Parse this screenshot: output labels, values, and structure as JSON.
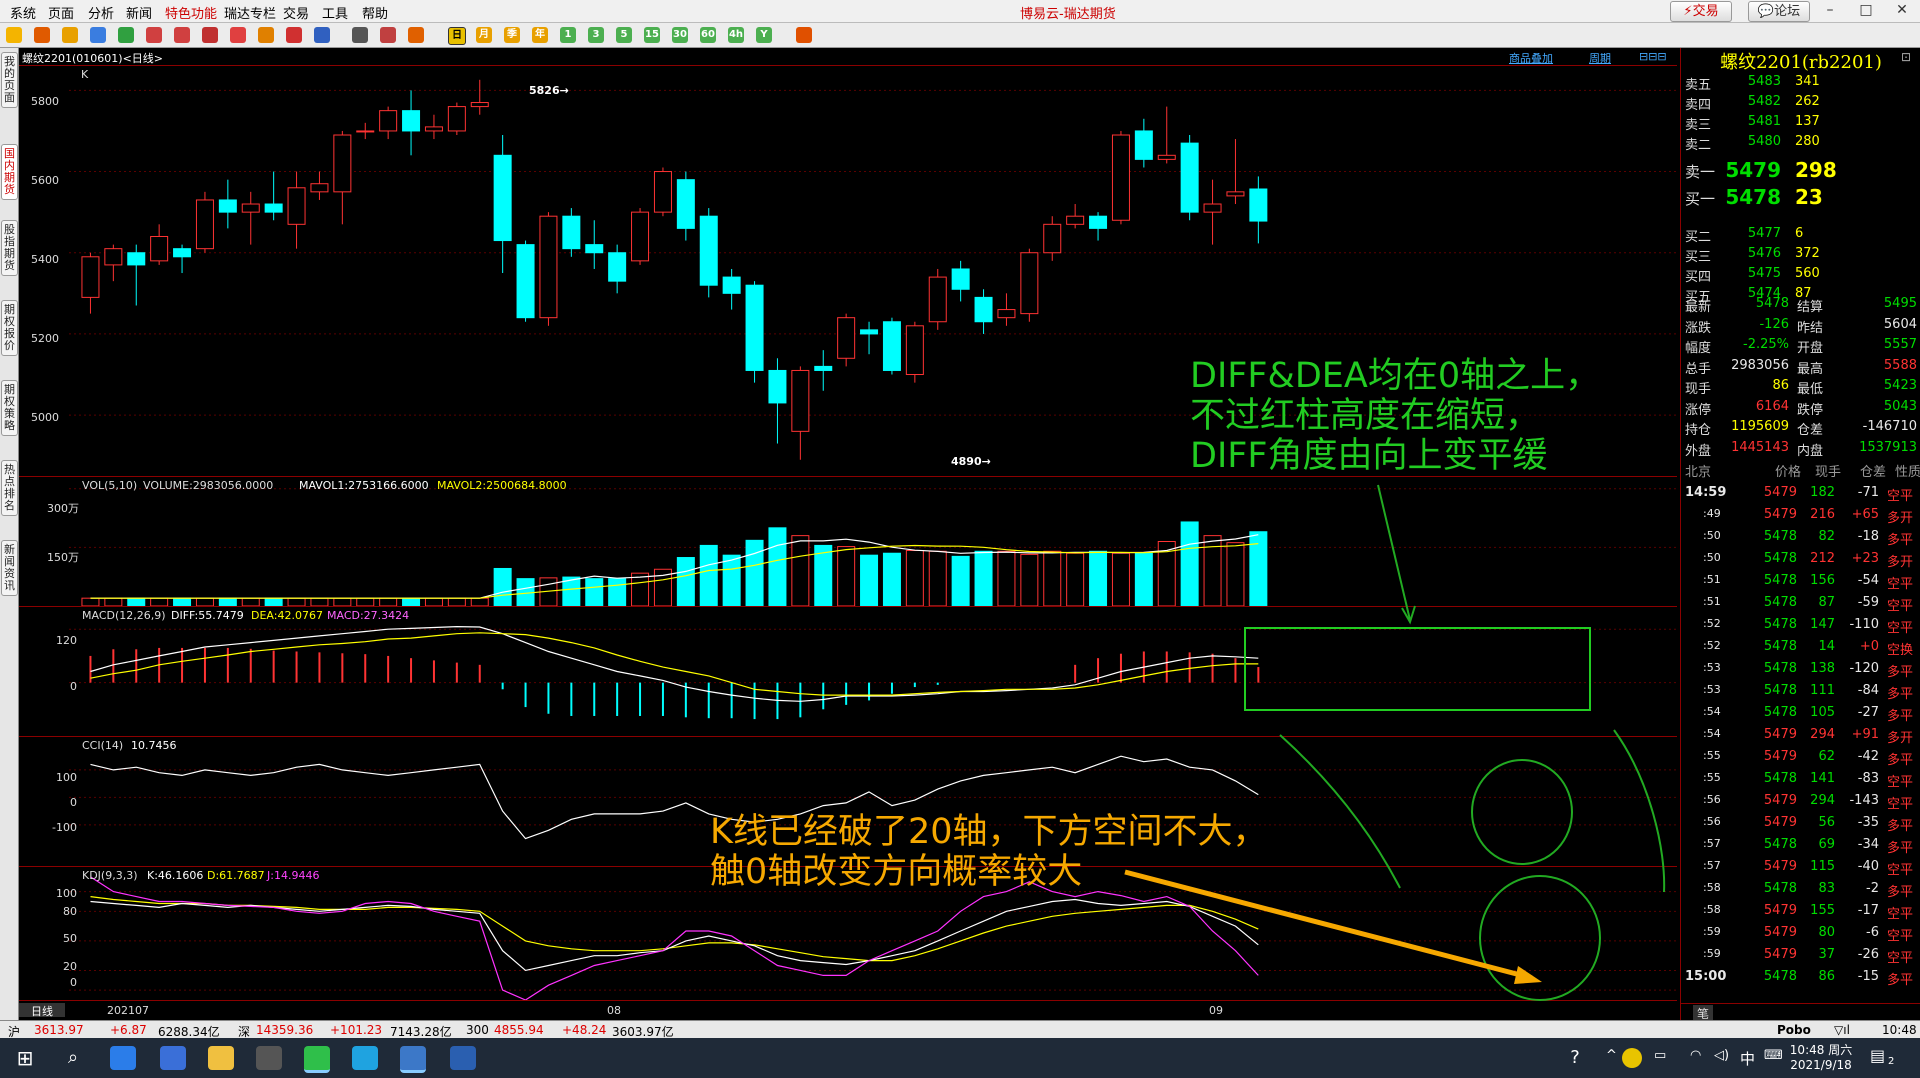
{
  "menu": {
    "items": [
      "系统",
      "页面",
      "分析",
      "新闻",
      "特色功能",
      "瑞达专栏",
      "交易",
      "工具",
      "帮助"
    ],
    "app_title": "博易云-瑞达期货",
    "trade_button": "交易",
    "forum_button": "论坛"
  },
  "toolbar": {
    "period_buttons": [
      "日",
      "月",
      "季",
      "年",
      "1",
      "3",
      "5",
      "15",
      "30",
      "60",
      "4h",
      "Y"
    ]
  },
  "sidebar": {
    "tabs": [
      "我的页面",
      "国内期货",
      "股指期货",
      "期权报价",
      "期权策略",
      "热点排名",
      "新闻资讯"
    ]
  },
  "chart": {
    "title": "螺纹2201(010601)<日线>",
    "overlay_link": "商品叠加",
    "period_link": "周期",
    "k_label": "K",
    "high_marker": "5826",
    "low_marker": "4890",
    "price_axis": [
      "5800",
      "5600",
      "5400",
      "5200",
      "5000"
    ],
    "vol": {
      "name": "VOL(5,10)",
      "volume": "VOLUME:2983056.0000",
      "mavol1": "MAVOL1:2753166.6000",
      "mavol2": "MAVOL2:2500684.8000",
      "axis": [
        "300万",
        "150万"
      ]
    },
    "macd": {
      "name": "MACD(12,26,9)",
      "diff": "DIFF:55.7479",
      "dea": "DEA:42.0767",
      "macd": "MACD:27.3424",
      "axis": [
        "120",
        "0"
      ]
    },
    "cci": {
      "name": "CCI(14)",
      "value": "10.7456",
      "axis": [
        "100",
        "0",
        "-100"
      ]
    },
    "kdj": {
      "name": "KDJ(9,3,3)",
      "k": "K:46.1606",
      "d": "D:61.7687",
      "j": "J:14.9446",
      "axis": [
        "100",
        "80",
        "50",
        "20",
        "0"
      ]
    },
    "x_labels": [
      "202107",
      "08",
      "09"
    ],
    "period_tab": "日线"
  },
  "annotations": {
    "macd_note": [
      "DIFF&DEA均在0轴之上，",
      "不过红柱高度在缩短，",
      "DIFF角度由向上变平缓"
    ],
    "k_note": [
      "K线已经破了20轴，下方空间不大，",
      "触0轴改变方向概率较大"
    ]
  },
  "quote": {
    "title": "螺纹2201(rb2201)",
    "asks": [
      {
        "label": "卖五",
        "price": "5483",
        "vol": "341"
      },
      {
        "label": "卖四",
        "price": "5482",
        "vol": "262"
      },
      {
        "label": "卖三",
        "price": "5481",
        "vol": "137"
      },
      {
        "label": "卖二",
        "price": "5480",
        "vol": "280"
      },
      {
        "label": "卖一",
        "price": "5479",
        "vol": "298"
      }
    ],
    "bids": [
      {
        "label": "买一",
        "price": "5478",
        "vol": "23"
      },
      {
        "label": "买二",
        "price": "5477",
        "vol": "6"
      },
      {
        "label": "买三",
        "price": "5476",
        "vol": "372"
      },
      {
        "label": "买四",
        "price": "5475",
        "vol": "560"
      },
      {
        "label": "买五",
        "price": "5474",
        "vol": "87"
      }
    ],
    "stats": [
      {
        "l1": "最新",
        "v1": "5478",
        "l2": "结算",
        "v2": "5495"
      },
      {
        "l1": "涨跌",
        "v1": "-126",
        "l2": "昨结",
        "v2": "5604"
      },
      {
        "l1": "幅度",
        "v1": "-2.25%",
        "l2": "开盘",
        "v2": "5557"
      },
      {
        "l1": "总手",
        "v1": "2983056",
        "l2": "最高",
        "v2": "5588"
      },
      {
        "l1": "现手",
        "v1": "86",
        "l2": "最低",
        "v2": "5423"
      },
      {
        "l1": "涨停",
        "v1": "6164",
        "l2": "跌停",
        "v2": "5043"
      },
      {
        "l1": "持仓",
        "v1": "1195609",
        "l2": "仓差",
        "v2": "-146710"
      },
      {
        "l1": "外盘",
        "v1": "1445143",
        "l2": "内盘",
        "v2": "1537913"
      }
    ],
    "ticks_header": [
      "北京",
      "价格",
      "现手",
      "仓差",
      "性质"
    ],
    "ticks": [
      {
        "t": "14:59",
        "p": "5479",
        "v": "182",
        "d": "-71",
        "n": "空平"
      },
      {
        "t": ":49",
        "p": "5479",
        "v": "216",
        "d": "+65",
        "n": "多开"
      },
      {
        "t": ":50",
        "p": "5478",
        "v": "82",
        "d": "-18",
        "n": "多平"
      },
      {
        "t": ":50",
        "p": "5478",
        "v": "212",
        "d": "+23",
        "n": "多开"
      },
      {
        "t": ":51",
        "p": "5478",
        "v": "156",
        "d": "-54",
        "n": "空平"
      },
      {
        "t": ":51",
        "p": "5478",
        "v": "87",
        "d": "-59",
        "n": "空平"
      },
      {
        "t": ":52",
        "p": "5478",
        "v": "147",
        "d": "-110",
        "n": "空平"
      },
      {
        "t": ":52",
        "p": "5478",
        "v": "14",
        "d": "+0",
        "n": "空换"
      },
      {
        "t": ":53",
        "p": "5478",
        "v": "138",
        "d": "-120",
        "n": "多平"
      },
      {
        "t": ":53",
        "p": "5478",
        "v": "111",
        "d": "-84",
        "n": "多平"
      },
      {
        "t": ":54",
        "p": "5478",
        "v": "105",
        "d": "-27",
        "n": "多平"
      },
      {
        "t": ":54",
        "p": "5479",
        "v": "294",
        "d": "+91",
        "n": "多开"
      },
      {
        "t": ":55",
        "p": "5479",
        "v": "62",
        "d": "-42",
        "n": "多平"
      },
      {
        "t": ":55",
        "p": "5478",
        "v": "141",
        "d": "-83",
        "n": "空平"
      },
      {
        "t": ":56",
        "p": "5479",
        "v": "294",
        "d": "-143",
        "n": "空平"
      },
      {
        "t": ":56",
        "p": "5479",
        "v": "56",
        "d": "-35",
        "n": "多平"
      },
      {
        "t": ":57",
        "p": "5478",
        "v": "69",
        "d": "-34",
        "n": "多平"
      },
      {
        "t": ":57",
        "p": "5479",
        "v": "115",
        "d": "-40",
        "n": "空平"
      },
      {
        "t": ":58",
        "p": "5478",
        "v": "83",
        "d": "-2",
        "n": "多平"
      },
      {
        "t": ":58",
        "p": "5479",
        "v": "155",
        "d": "-17",
        "n": "空平"
      },
      {
        "t": ":59",
        "p": "5479",
        "v": "80",
        "d": "-6",
        "n": "空平"
      },
      {
        "t": ":59",
        "p": "5479",
        "v": "37",
        "d": "-26",
        "n": "空平"
      },
      {
        "t": "15:00",
        "p": "5478",
        "v": "86",
        "d": "-15",
        "n": "多平"
      }
    ],
    "bottom_tab": "笔"
  },
  "statusbar": {
    "items": [
      "沪",
      "3613.97",
      "+6.87",
      "6288.34亿",
      "深",
      "14359.36",
      "+101.23",
      "7143.28亿",
      "300",
      "4855.94",
      "+48.24",
      "3603.97亿"
    ],
    "brand": "Pobo",
    "time": "10:48"
  },
  "taskbar": {
    "ime": "中",
    "time": "10:48 周六",
    "date": "2021/9/18",
    "notif_count": "2"
  },
  "chart_data": {
    "type": "candlestick",
    "candles": [
      {
        "o": 5290,
        "c": 5390,
        "h": 5400,
        "l": 5250
      },
      {
        "o": 5370,
        "c": 5410,
        "h": 5420,
        "l": 5330
      },
      {
        "o": 5400,
        "c": 5370,
        "h": 5420,
        "l": 5270
      },
      {
        "o": 5380,
        "c": 5440,
        "h": 5470,
        "l": 5370
      },
      {
        "o": 5410,
        "c": 5390,
        "h": 5420,
        "l": 5350
      },
      {
        "o": 5410,
        "c": 5530,
        "h": 5550,
        "l": 5400
      },
      {
        "o": 5530,
        "c": 5500,
        "h": 5580,
        "l": 5460
      },
      {
        "o": 5500,
        "c": 5520,
        "h": 5550,
        "l": 5420
      },
      {
        "o": 5520,
        "c": 5500,
        "h": 5600,
        "l": 5480
      },
      {
        "o": 5470,
        "c": 5560,
        "h": 5600,
        "l": 5410
      },
      {
        "o": 5550,
        "c": 5570,
        "h": 5600,
        "l": 5530
      },
      {
        "o": 5550,
        "c": 5690,
        "h": 5700,
        "l": 5470
      },
      {
        "o": 5700,
        "c": 5700,
        "h": 5720,
        "l": 5680
      },
      {
        "o": 5700,
        "c": 5750,
        "h": 5760,
        "l": 5680
      },
      {
        "o": 5750,
        "c": 5700,
        "h": 5800,
        "l": 5640
      },
      {
        "o": 5700,
        "c": 5710,
        "h": 5740,
        "l": 5680
      },
      {
        "o": 5700,
        "c": 5760,
        "h": 5770,
        "l": 5690
      },
      {
        "o": 5760,
        "c": 5770,
        "h": 5826,
        "l": 5740
      },
      {
        "o": 5640,
        "c": 5430,
        "h": 5690,
        "l": 5350
      },
      {
        "o": 5420,
        "c": 5240,
        "h": 5430,
        "l": 5230
      },
      {
        "o": 5240,
        "c": 5490,
        "h": 5500,
        "l": 5220
      },
      {
        "o": 5490,
        "c": 5410,
        "h": 5510,
        "l": 5390
      },
      {
        "o": 5420,
        "c": 5400,
        "h": 5480,
        "l": 5360
      },
      {
        "o": 5400,
        "c": 5330,
        "h": 5420,
        "l": 5300
      },
      {
        "o": 5380,
        "c": 5500,
        "h": 5510,
        "l": 5370
      },
      {
        "o": 5500,
        "c": 5600,
        "h": 5610,
        "l": 5490
      },
      {
        "o": 5580,
        "c": 5460,
        "h": 5600,
        "l": 5430
      },
      {
        "o": 5490,
        "c": 5320,
        "h": 5510,
        "l": 5290
      },
      {
        "o": 5340,
        "c": 5300,
        "h": 5360,
        "l": 5260
      },
      {
        "o": 5320,
        "c": 5110,
        "h": 5330,
        "l": 5080
      },
      {
        "o": 5110,
        "c": 5030,
        "h": 5140,
        "l": 4930
      },
      {
        "o": 4960,
        "c": 5110,
        "h": 5120,
        "l": 4890
      },
      {
        "o": 5120,
        "c": 5110,
        "h": 5160,
        "l": 5060
      },
      {
        "o": 5140,
        "c": 5240,
        "h": 5250,
        "l": 5120
      },
      {
        "o": 5210,
        "c": 5200,
        "h": 5230,
        "l": 5150
      },
      {
        "o": 5230,
        "c": 5110,
        "h": 5240,
        "l": 5100
      },
      {
        "o": 5100,
        "c": 5220,
        "h": 5230,
        "l": 5080
      },
      {
        "o": 5230,
        "c": 5340,
        "h": 5360,
        "l": 5210
      },
      {
        "o": 5360,
        "c": 5310,
        "h": 5380,
        "l": 5280
      },
      {
        "o": 5290,
        "c": 5230,
        "h": 5310,
        "l": 5200
      },
      {
        "o": 5240,
        "c": 5260,
        "h": 5300,
        "l": 5220
      },
      {
        "o": 5250,
        "c": 5400,
        "h": 5410,
        "l": 5230
      },
      {
        "o": 5400,
        "c": 5470,
        "h": 5490,
        "l": 5380
      },
      {
        "o": 5470,
        "c": 5490,
        "h": 5520,
        "l": 5460
      },
      {
        "o": 5490,
        "c": 5460,
        "h": 5500,
        "l": 5430
      },
      {
        "o": 5480,
        "c": 5690,
        "h": 5700,
        "l": 5470
      },
      {
        "o": 5700,
        "c": 5630,
        "h": 5730,
        "l": 5610
      },
      {
        "o": 5630,
        "c": 5640,
        "h": 5760,
        "l": 5620
      },
      {
        "o": 5670,
        "c": 5500,
        "h": 5690,
        "l": 5480
      },
      {
        "o": 5500,
        "c": 5520,
        "h": 5580,
        "l": 5420
      },
      {
        "o": 5540,
        "c": 5550,
        "h": 5680,
        "l": 5520
      },
      {
        "o": 5557,
        "c": 5478,
        "h": 5588,
        "l": 5423
      }
    ],
    "volume_wan": [
      20,
      20,
      20,
      20,
      20,
      20,
      20,
      20,
      20,
      20,
      20,
      20,
      20,
      20,
      20,
      20,
      20,
      20,
      96,
      70,
      72,
      74,
      70,
      70,
      84,
      94,
      124,
      155,
      130,
      168,
      200,
      180,
      155,
      152,
      130,
      135,
      142,
      140,
      127,
      140,
      140,
      132,
      140,
      135,
      140,
      135,
      135,
      165,
      215,
      180,
      162,
      190
    ],
    "macd_hist": [
      60,
      75,
      75,
      78,
      78,
      78,
      78,
      76,
      72,
      70,
      68,
      66,
      64,
      60,
      55,
      50,
      45,
      40,
      -15,
      -55,
      -70,
      -75,
      -75,
      -75,
      -75,
      -75,
      -78,
      -80,
      -80,
      -82,
      -82,
      -78,
      -60,
      -50,
      -40,
      -25,
      -10,
      -5,
      0,
      0,
      0,
      0,
      0,
      40,
      55,
      65,
      70,
      70,
      68,
      65,
      55,
      35
    ],
    "diff": [
      25,
      40,
      50,
      60,
      70,
      80,
      85,
      90,
      95,
      100,
      105,
      110,
      115,
      120,
      122,
      124,
      126,
      125,
      110,
      90,
      70,
      55,
      40,
      25,
      15,
      5,
      -10,
      -20,
      -28,
      -35,
      -40,
      -42,
      -38,
      -30,
      -30,
      -30,
      -28,
      -25,
      -20,
      -20,
      -18,
      -15,
      -12,
      -5,
      10,
      25,
      35,
      45,
      55,
      60,
      58,
      55
    ],
    "dea": [
      10,
      20,
      28,
      40,
      48,
      55,
      62,
      70,
      75,
      80,
      85,
      88,
      92,
      98,
      100,
      105,
      110,
      112,
      110,
      108,
      100,
      90,
      78,
      62,
      48,
      35,
      25,
      15,
      0,
      -15,
      -20,
      -25,
      -28,
      -28,
      -28,
      -28,
      -25,
      -22,
      -20,
      -18,
      -15,
      -15,
      -15,
      -12,
      -5,
      5,
      15,
      25,
      32,
      38,
      42,
      42
    ],
    "cci": [
      120,
      100,
      110,
      90,
      80,
      100,
      90,
      80,
      90,
      110,
      120,
      100,
      90,
      80,
      90,
      100,
      110,
      120,
      -50,
      -150,
      -120,
      -80,
      -60,
      -60,
      -60,
      -50,
      -20,
      -60,
      -80,
      -90,
      -80,
      -60,
      -30,
      -20,
      20,
      -30,
      -10,
      30,
      60,
      80,
      90,
      100,
      110,
      90,
      120,
      150,
      130,
      140,
      110,
      100,
      60,
      10
    ],
    "kdj_k": [
      90,
      88,
      86,
      84,
      88,
      86,
      84,
      86,
      84,
      82,
      80,
      82,
      84,
      86,
      85,
      82,
      80,
      78,
      40,
      20,
      25,
      30,
      35,
      35,
      38,
      40,
      50,
      55,
      50,
      45,
      35,
      30,
      28,
      26,
      30,
      35,
      40,
      50,
      60,
      70,
      80,
      85,
      90,
      92,
      88,
      86,
      88,
      90,
      85,
      75,
      65,
      46
    ],
    "kdj_d": [
      95,
      92,
      90,
      88,
      88,
      88,
      86,
      86,
      85,
      84,
      82,
      82,
      82,
      84,
      84,
      83,
      82,
      80,
      65,
      50,
      45,
      42,
      40,
      40,
      40,
      42,
      45,
      48,
      48,
      46,
      42,
      38,
      34,
      32,
      30,
      30,
      35,
      42,
      50,
      58,
      65,
      70,
      75,
      78,
      80,
      82,
      84,
      86,
      86,
      80,
      72,
      62
    ],
    "kdj_j": [
      115,
      100,
      95,
      90,
      90,
      88,
      86,
      85,
      84,
      80,
      78,
      80,
      88,
      90,
      88,
      80,
      75,
      70,
      0,
      -10,
      5,
      15,
      25,
      30,
      35,
      40,
      60,
      60,
      55,
      40,
      25,
      20,
      15,
      15,
      30,
      40,
      50,
      60,
      80,
      95,
      100,
      110,
      100,
      95,
      100,
      96,
      90,
      95,
      85,
      60,
      40,
      15
    ],
    "ylim_price": [
      4850,
      5860
    ],
    "ylim_vol": [
      0,
      330
    ],
    "ylim_macd": [
      -120,
      170
    ],
    "ylim_cci": [
      -250,
      220
    ],
    "ylim_kdj": [
      -10,
      125
    ]
  }
}
